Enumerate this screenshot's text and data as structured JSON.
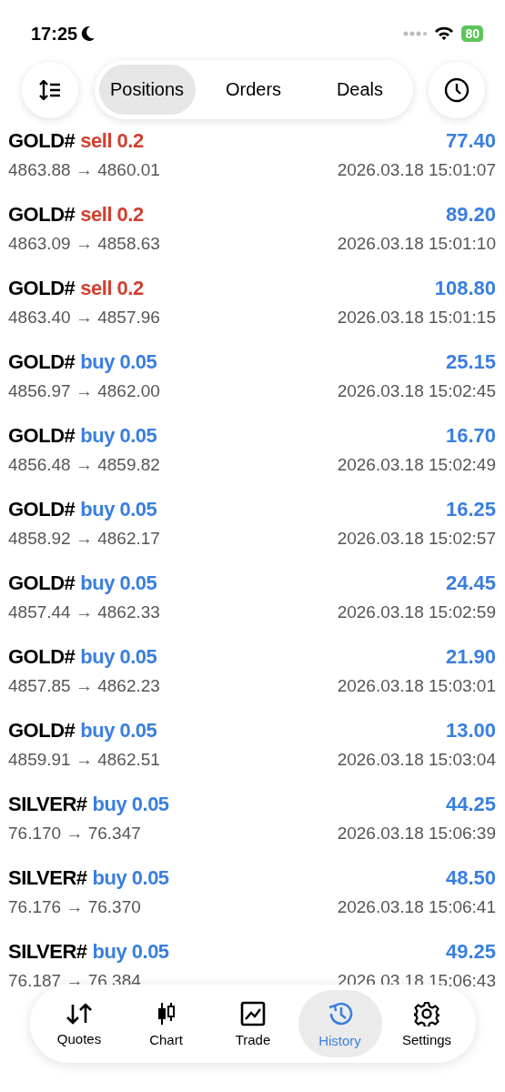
{
  "status_bar": {
    "time": "17:25",
    "battery": "80"
  },
  "header": {
    "tabs": [
      {
        "label": "Positions",
        "selected": true
      },
      {
        "label": "Orders",
        "selected": false
      },
      {
        "label": "Deals",
        "selected": false
      }
    ]
  },
  "deals": [
    {
      "symbol": "GOLD#",
      "kind": "sell",
      "trade": "sell 0.2",
      "profit": "77.40",
      "prices": "4863.88 → 4860.01",
      "time": "2026.03.18 15:01:07"
    },
    {
      "symbol": "GOLD#",
      "kind": "sell",
      "trade": "sell 0.2",
      "profit": "89.20",
      "prices": "4863.09 → 4858.63",
      "time": "2026.03.18 15:01:10"
    },
    {
      "symbol": "GOLD#",
      "kind": "sell",
      "trade": "sell 0.2",
      "profit": "108.80",
      "prices": "4863.40 → 4857.96",
      "time": "2026.03.18 15:01:15"
    },
    {
      "symbol": "GOLD#",
      "kind": "buy",
      "trade": "buy 0.05",
      "profit": "25.15",
      "prices": "4856.97 → 4862.00",
      "time": "2026.03.18 15:02:45"
    },
    {
      "symbol": "GOLD#",
      "kind": "buy",
      "trade": "buy 0.05",
      "profit": "16.70",
      "prices": "4856.48 → 4859.82",
      "time": "2026.03.18 15:02:49"
    },
    {
      "symbol": "GOLD#",
      "kind": "buy",
      "trade": "buy 0.05",
      "profit": "16.25",
      "prices": "4858.92 → 4862.17",
      "time": "2026.03.18 15:02:57"
    },
    {
      "symbol": "GOLD#",
      "kind": "buy",
      "trade": "buy 0.05",
      "profit": "24.45",
      "prices": "4857.44 → 4862.33",
      "time": "2026.03.18 15:02:59"
    },
    {
      "symbol": "GOLD#",
      "kind": "buy",
      "trade": "buy 0.05",
      "profit": "21.90",
      "prices": "4857.85 → 4862.23",
      "time": "2026.03.18 15:03:01"
    },
    {
      "symbol": "GOLD#",
      "kind": "buy",
      "trade": "buy 0.05",
      "profit": "13.00",
      "prices": "4859.91 → 4862.51",
      "time": "2026.03.18 15:03:04"
    },
    {
      "symbol": "SILVER#",
      "kind": "buy",
      "trade": "buy 0.05",
      "profit": "44.25",
      "prices": "76.170 → 76.347",
      "time": "2026.03.18 15:06:39"
    },
    {
      "symbol": "SILVER#",
      "kind": "buy",
      "trade": "buy 0.05",
      "profit": "48.50",
      "prices": "76.176 → 76.370",
      "time": "2026.03.18 15:06:41"
    },
    {
      "symbol": "SILVER#",
      "kind": "buy",
      "trade": "buy 0.05",
      "profit": "49.25",
      "prices": "76.187 → 76.384",
      "time": "2026.03.18 15:06:43"
    }
  ],
  "tab_bar": [
    {
      "label": "Quotes",
      "kind": "quotes",
      "selected": false
    },
    {
      "label": "Chart",
      "kind": "chart",
      "selected": false
    },
    {
      "label": "Trade",
      "kind": "trade",
      "selected": false
    },
    {
      "label": "History",
      "kind": "history",
      "selected": true
    },
    {
      "label": "Settings",
      "kind": "settings",
      "selected": false
    }
  ]
}
